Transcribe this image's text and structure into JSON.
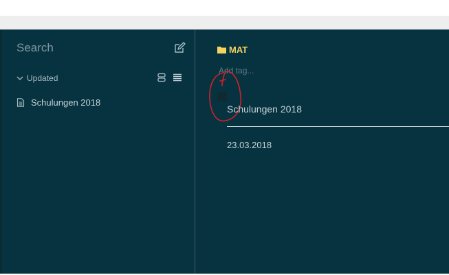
{
  "sidebar": {
    "search_placeholder": "Search",
    "sort_label": "Updated",
    "notes": [
      {
        "title": "Schulungen 2018"
      }
    ]
  },
  "editor": {
    "notebook": "MAT",
    "tag_placeholder": "Add tag...",
    "title": "Schulungen 2018",
    "body_date": "23.03.2018"
  },
  "colors": {
    "background": "#06333f",
    "notebook_accent": "#f4d35e",
    "annotation": "#d4202a"
  },
  "icons": {
    "compose": "compose-icon",
    "chevron": "chevron-down-icon",
    "expanded_view": "expanded-view-icon",
    "list_view": "list-view-icon",
    "note": "document-icon",
    "notebook": "folder-icon"
  }
}
